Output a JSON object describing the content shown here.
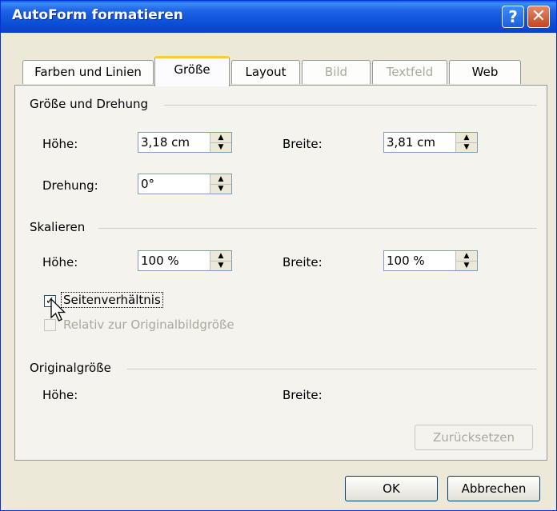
{
  "window": {
    "title": "AutoForm formatieren",
    "help_glyph": "?",
    "close_glyph": "✕"
  },
  "tabs": [
    {
      "label": "Farben und Linien",
      "state": "normal"
    },
    {
      "label": "Größe",
      "state": "active"
    },
    {
      "label": "Layout",
      "state": "normal"
    },
    {
      "label": "Bild",
      "state": "disabled"
    },
    {
      "label": "Textfeld",
      "state": "disabled"
    },
    {
      "label": "Web",
      "state": "normal"
    }
  ],
  "size_rotation": {
    "group_label": "Größe und Drehung",
    "height_label": "Höhe:",
    "height_value": "3,18 cm",
    "width_label": "Breite:",
    "width_value": "3,81 cm",
    "rotation_label": "Drehung:",
    "rotation_value": "0°"
  },
  "scale": {
    "group_label": "Skalieren",
    "height_label": "Höhe:",
    "height_value": "100 %",
    "width_label": "Breite:",
    "width_value": "100 %",
    "lock_aspect_label": "Seitenverhältnis",
    "lock_aspect_checked": true,
    "relative_label": "Relativ zur Originalbildgröße",
    "relative_checked": false
  },
  "original_size": {
    "group_label": "Originalgröße",
    "height_label": "Höhe:",
    "width_label": "Breite:",
    "reset_label": "Zurücksetzen"
  },
  "footer": {
    "ok_label": "OK",
    "cancel_label": "Abbrechen"
  },
  "colors": {
    "title_bar": "#0a4fd6",
    "dialog_bg": "#ece9d8",
    "panel_bg": "#f4f3ee",
    "active_tab_accent": "#ffc83c"
  }
}
